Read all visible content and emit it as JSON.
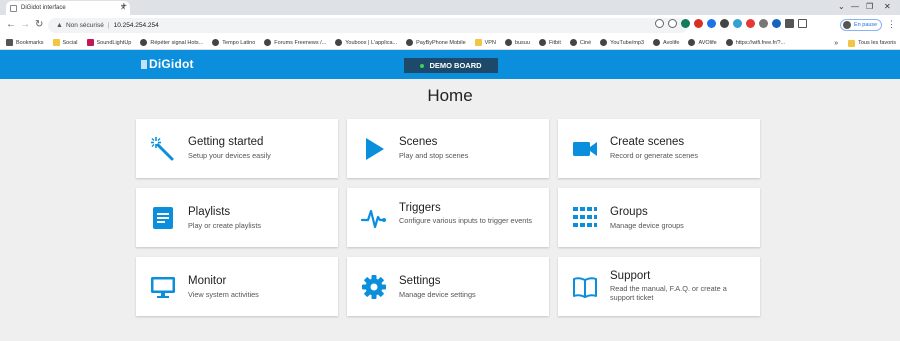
{
  "browser": {
    "tab_title": "DiGidot interface",
    "security_label": "Non sécurisé",
    "url": "10.254.254.254",
    "profile_label": "En pause",
    "bookmarks": [
      "Bookmarks",
      "Social",
      "SoundLightUp",
      "Répéter signal Hots...",
      "Tempo Latino",
      "Forums Freenews /...",
      "Youboox | L'applica...",
      "PayByPhone Mobile",
      "VPN",
      "busuu",
      "Fitbit",
      "Ciné",
      "YouTube/mp3",
      "Avolife",
      "AVOlife",
      "https://wifi.free.fr/?..."
    ],
    "other_bookmarks": "Tous les favoris",
    "more_bookmarks": "»"
  },
  "app": {
    "logo": "DiGidot",
    "board_name": "DEMO BOARD",
    "page_title": "Home",
    "accent_color": "#0b8fdc"
  },
  "cards": [
    {
      "title": "Getting started",
      "subtitle": "Setup your devices easily",
      "icon": "magic-wand-icon"
    },
    {
      "title": "Scenes",
      "subtitle": "Play and stop scenes",
      "icon": "play-icon"
    },
    {
      "title": "Create scenes",
      "subtitle": "Record or generate scenes",
      "icon": "video-camera-icon"
    },
    {
      "title": "Playlists",
      "subtitle": "Play or create playlists",
      "icon": "playlist-icon"
    },
    {
      "title": "Triggers",
      "subtitle": "Configure various inputs to trigger events",
      "icon": "pulse-icon"
    },
    {
      "title": "Groups",
      "subtitle": "Manage device groups",
      "icon": "groups-grid-icon"
    },
    {
      "title": "Monitor",
      "subtitle": "View system activities",
      "icon": "monitor-icon"
    },
    {
      "title": "Settings",
      "subtitle": "Manage device settings",
      "icon": "gear-icon"
    },
    {
      "title": "Support",
      "subtitle": "Read the manual, F.A.Q. or create a support ticket",
      "icon": "book-icon"
    }
  ]
}
